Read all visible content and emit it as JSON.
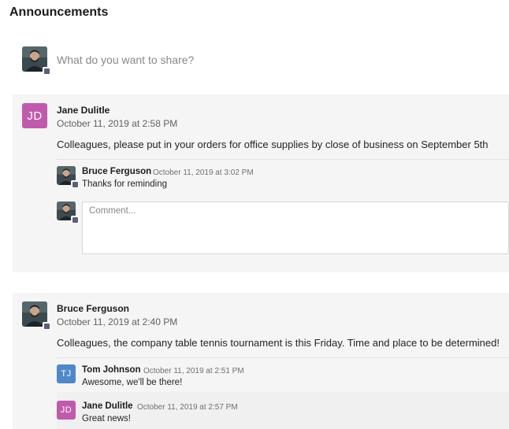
{
  "header": {
    "title": "Announcements"
  },
  "composer": {
    "placeholder": "What do you want to share?",
    "avatar_icon": "user-photo-icon"
  },
  "colors": {
    "jd": "#c05bab",
    "tj": "#4f88c9",
    "card_bg": "#f5f5f5"
  },
  "posts": [
    {
      "author": "Jane Dulitle",
      "initials": "JD",
      "date": "October 11, 2019 at 2:58 PM",
      "body": "Colleagues, please put in your orders for office supplies by close of business on September 5th",
      "replies": [
        {
          "author": "Bruce Ferguson",
          "date": "October 11, 2019 at 3:02 PM",
          "body": "Thanks for reminding"
        }
      ],
      "comment_placeholder": "Comment..."
    },
    {
      "author": "Bruce Ferguson",
      "date": "October 11, 2019 at 2:40 PM",
      "body": "Colleagues, the company table tennis tournament is this Friday. Time and place to be determined!",
      "replies": [
        {
          "author": "Tom Johnson",
          "initials": "TJ",
          "date": "October 11, 2019 at 2:51 PM",
          "body": "Awesome, we'll be there!"
        },
        {
          "author": "Jane Dulitle",
          "initials": "JD",
          "date": "October 11, 2019 at 2:57 PM",
          "body": "Great news!"
        }
      ]
    }
  ]
}
